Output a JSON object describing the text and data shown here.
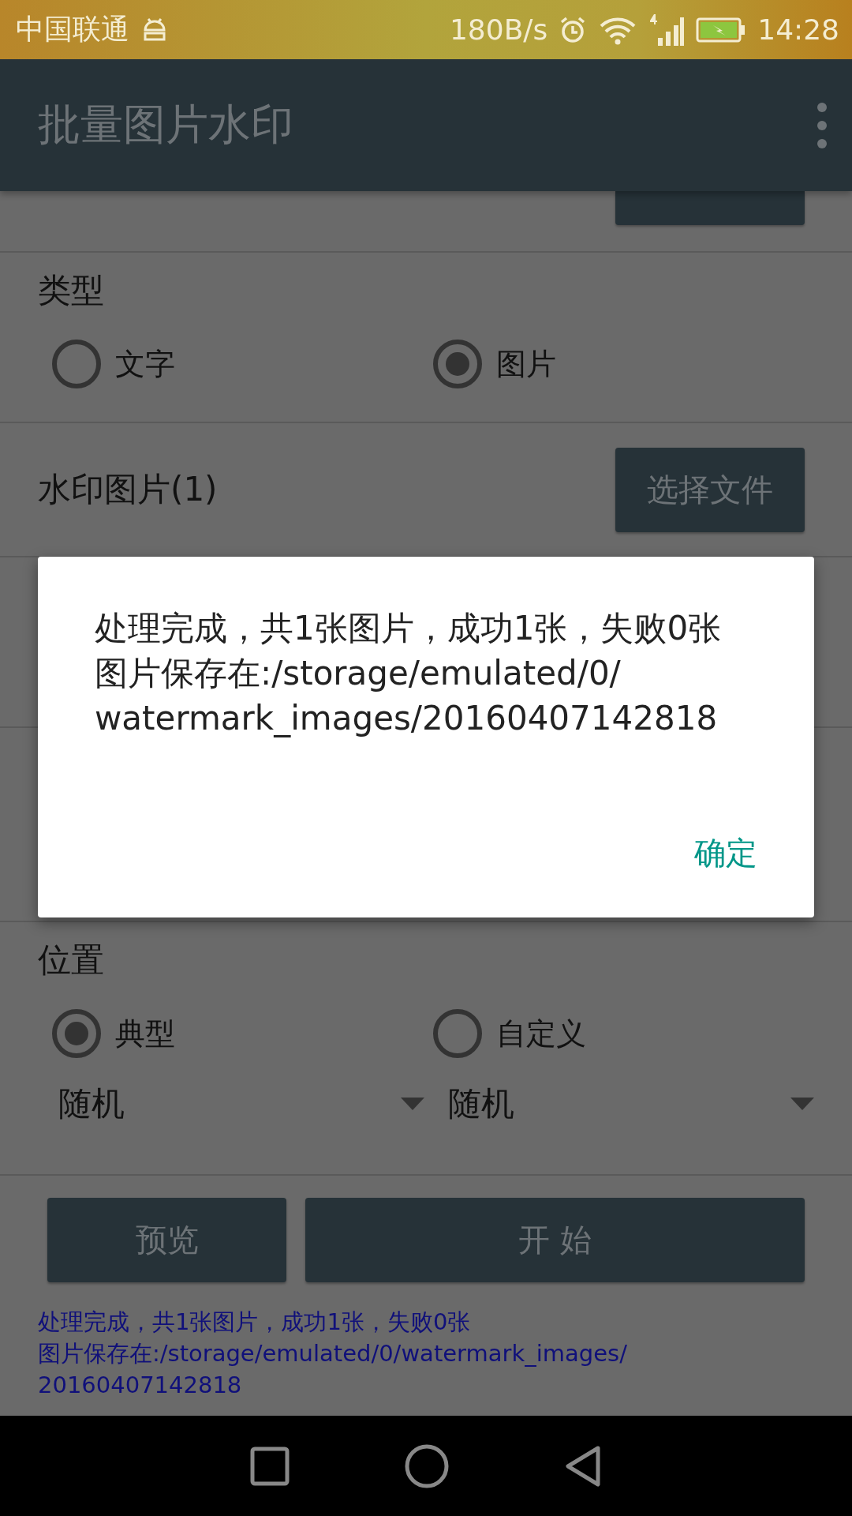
{
  "status_bar": {
    "carrier": "中国联通",
    "net_speed": "180B/s",
    "time": "14:28"
  },
  "app_bar": {
    "title": "批量图片水印"
  },
  "form": {
    "type_section": {
      "label": "类型",
      "options": [
        {
          "label": "文字",
          "selected": false
        },
        {
          "label": "图片",
          "selected": true
        }
      ]
    },
    "watermark_row": {
      "label": "水印图片(1)",
      "button": "选择文件"
    },
    "position_section": {
      "label": "位置",
      "options": [
        {
          "label": "典型",
          "selected": true
        },
        {
          "label": "自定义",
          "selected": false
        }
      ],
      "dropdowns": [
        "随机",
        "随机"
      ]
    },
    "buttons": [
      "预览",
      "开 始"
    ],
    "result": [
      "处理完成，共1张图片，成功1张，失败0张",
      "图片保存在:/storage/emulated/0/watermark_images/",
      "20160407142818"
    ]
  },
  "dialog": {
    "message": [
      "处理完成，共1张图片，成功1张，失败0张",
      "图片保存在:/storage/emulated/0/",
      "watermark_images/20160407142818"
    ],
    "button": "确定"
  }
}
